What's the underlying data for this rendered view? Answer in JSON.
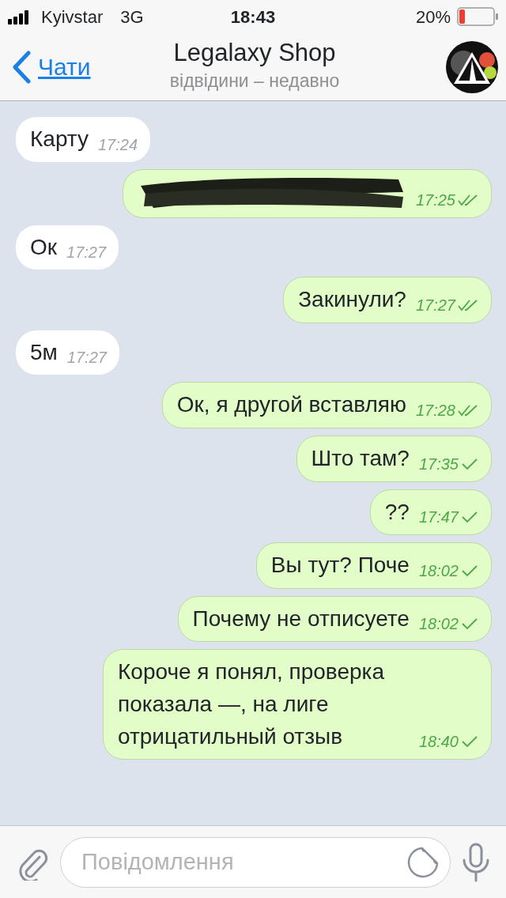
{
  "status_bar": {
    "carrier": "Kyivstar",
    "network": "3G",
    "time": "18:43",
    "battery": "20%"
  },
  "header": {
    "back": "Чати",
    "title": "Legalaxy Shop",
    "subtitle": "відвідини – недавно"
  },
  "messages": [
    {
      "kind": "in",
      "text": "Карту",
      "time": "17:24"
    },
    {
      "kind": "redacted",
      "time": "17:25",
      "read": true
    },
    {
      "kind": "in",
      "text": "Ок",
      "time": "17:27"
    },
    {
      "kind": "out",
      "text": "Закинули?",
      "time": "17:27",
      "read": true
    },
    {
      "kind": "in",
      "text": "5м",
      "time": "17:27"
    },
    {
      "kind": "out",
      "text": "Ок, я другой вставляю",
      "time": "17:28",
      "read": true
    },
    {
      "kind": "out",
      "text": "Што там?",
      "time": "17:35",
      "read": false
    },
    {
      "kind": "out",
      "text": "??",
      "time": "17:47",
      "read": false
    },
    {
      "kind": "out",
      "text": "Вы тут? Поче",
      "time": "18:02",
      "read": false
    },
    {
      "kind": "out",
      "text": "Почему не отписуете",
      "time": "18:02",
      "read": false
    },
    {
      "kind": "out",
      "text": "Короче я понял, проверка показала —, на лиге отрицатильный отзыв",
      "time": "18:40",
      "read": false
    }
  ],
  "composer": {
    "placeholder": "Повідомлення"
  }
}
